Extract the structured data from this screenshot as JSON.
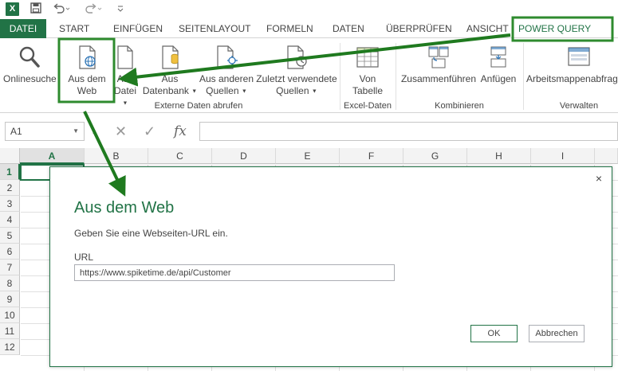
{
  "app": {
    "logo_text": "X",
    "accent_color": "#217346"
  },
  "tabs": [
    {
      "label": "DATEI"
    },
    {
      "label": "START"
    },
    {
      "label": "EINFÜGEN"
    },
    {
      "label": "SEITENLAYOUT"
    },
    {
      "label": "FORMELN"
    },
    {
      "label": "DATEN"
    },
    {
      "label": "ÜBERPRÜFEN"
    },
    {
      "label": "ANSICHT"
    },
    {
      "label": "POWER QUERY"
    }
  ],
  "ribbon": {
    "online_search": "Onlinesuche",
    "from_web_line1": "Aus dem",
    "from_web_line2": "Web",
    "from_file_line1": "Aus",
    "from_file_line2": "Datei",
    "from_db_line1": "Aus",
    "from_db_line2": "Datenbank",
    "from_other_line1": "Aus anderen",
    "from_other_line2": "Quellen",
    "recent_line1": "Zuletzt verwendete",
    "recent_line2": "Quellen",
    "from_table_line1": "Von",
    "from_table_line2": "Tabelle",
    "merge": "Zusammenführen",
    "append": "Anfügen",
    "workbook_queries": "Arbeitsmappenabfrag",
    "group_external": "Externe Daten abrufen",
    "group_excel": "Excel-Daten",
    "group_combine": "Kombinieren",
    "group_manage": "Verwalten"
  },
  "formula_bar": {
    "name_box": "A1",
    "fx": "fx",
    "cancel_glyph": "✕",
    "enter_glyph": "✓"
  },
  "grid": {
    "columns": [
      "A",
      "B",
      "C",
      "D",
      "E",
      "F",
      "G",
      "H",
      "I"
    ],
    "rows": [
      "1",
      "2",
      "3",
      "4",
      "5",
      "6",
      "7",
      "8",
      "9",
      "10",
      "11",
      "12"
    ]
  },
  "dialog": {
    "title": "Aus dem Web",
    "subtitle": "Geben Sie eine Webseiten-URL ein.",
    "url_label": "URL",
    "url_value": "https://www.spiketime.de/api/Customer",
    "ok_label": "OK",
    "cancel_label": "Abbrechen",
    "close_glyph": "×"
  }
}
